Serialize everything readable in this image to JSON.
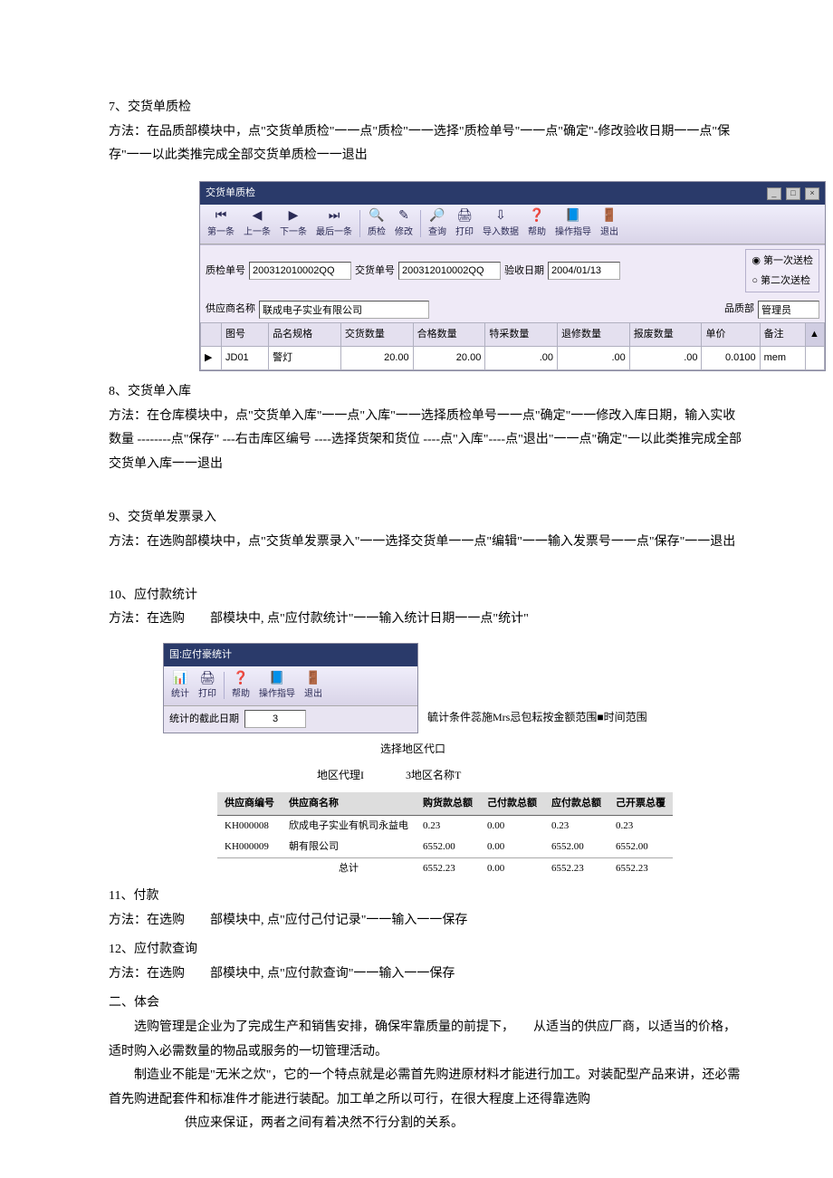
{
  "sec7": {
    "title": "7、交货单质检",
    "method": "方法：在品质部模块中，点\"交货单质检\"一一点\"质检\"一一选择\"质检单号\"一一点\"确定\"-修改验收日期一一点\"保存\"一一以此类推完成全部交货单质检一一退出"
  },
  "win1": {
    "title": "交货单质检",
    "toolbar": {
      "first": "第一条",
      "prev": "上一条",
      "next": "下一条",
      "last": "最后一条",
      "qc": "质检",
      "modify": "修改",
      "query": "查询",
      "print": "打印",
      "import": "导入数据",
      "help": "帮助",
      "guide": "操作指导",
      "exit": "退出"
    },
    "form": {
      "qc_no_lbl": "质检单号",
      "qc_no": "200312010002QQ",
      "dn_no_lbl": "交货单号",
      "dn_no": "200312010002QQ",
      "acc_date_lbl": "验收日期",
      "acc_date": "2004/01/13",
      "supplier_lbl": "供应商名称",
      "supplier": "联成电子实业有限公司",
      "dept_lbl": "品质部",
      "dept": "管理员",
      "r1": "第一次送检",
      "r2": "第二次送检"
    },
    "grid": {
      "cols": [
        "图号",
        "品名规格",
        "交货数量",
        "合格数量",
        "特采数量",
        "退修数量",
        "报废数量",
        "单价",
        "备注"
      ],
      "row_mark": "▶",
      "row": [
        "JD01",
        "警灯",
        "20.00",
        "20.00",
        ".00",
        ".00",
        ".00",
        "0.0100",
        "mem"
      ]
    }
  },
  "sec8": {
    "title": "8、交货单入库",
    "method": "方法：在仓库模块中，点\"交货单入库\"一一点\"入库\"一一选择质检单号一一点\"确定\"一一修改入库日期，输入实收数量 --------点\"保存\" ---右击库区编号 ----选择货架和货位 ----点\"入库\"----点\"退出\"一一点\"确定\"一以此类推完成全部交货单入库一一退出"
  },
  "sec9": {
    "title": "9、交货单发票录入",
    "method": "方法：在选购部模块中，点\"交货单发票录入\"一一选择交货单一一点\"编辑\"一一输入发票号一一点\"保存\"一一退出"
  },
  "sec10": {
    "title": "10、应付款统计",
    "method": "方法：在选购　　部模块中, 点\"应付款统计\"一一输入统计日期一一点\"统计\""
  },
  "win2": {
    "title": "国:应付豪统计",
    "toolbar": {
      "stat": "统计",
      "print": "打印",
      "help": "帮助",
      "guide": "操作指导",
      "exit": "退出"
    },
    "date_lbl": "统计的截此日期",
    "date_val": "3",
    "cond": "毓计条件蕊施Mrs忌包耘按金额范围■时间范围",
    "select_area": "选择地区代口",
    "area_agent_lbl": "地区代理I",
    "area_name_lbl": "3地区名称T"
  },
  "payable": {
    "sup_code_lbl": "供应商编号",
    "sup_name_lbl": "供应商名称",
    "cols": [
      "购货款总额",
      "己付款总额",
      "应付款总额",
      "己开票总覆"
    ],
    "rows": [
      {
        "code": "KH000008",
        "name": "欣成电子实业有帆司永益电",
        "v": [
          "0.23",
          "0.00",
          "0.23",
          "0.23"
        ]
      },
      {
        "code": "KH000009",
        "name": "朝有限公司",
        "v": [
          "6552.00",
          "0.00",
          "6552.00",
          "6552.00"
        ]
      }
    ],
    "total_lbl": "总计",
    "total": [
      "6552.23",
      "0.00",
      "6552.23",
      "6552.23"
    ]
  },
  "sec11": {
    "title": "11、付款",
    "method": "方法：在选购　　部模块中, 点\"应付己付记录\"一一输入一一保存"
  },
  "sec12": {
    "title": "12、应付款查询",
    "method": "方法：在选购　　部模块中, 点\"应付款查询\"一一输入一一保存"
  },
  "sec_tihui": {
    "title": "二、体会",
    "p1": "选购管理是企业为了完成生产和销售安排，确保牢靠质量的前提下，　　从适当的供应厂商，以适当的价格，适时购入必需数量的物品或服务的一切管理活动。",
    "p2": "制造业不能是\"无米之炊\"，它的一个特点就是必需首先购进原材料才能进行加工。对装配型产品来讲，还必需首先购进配套件和标准件才能进行装配。加工单之所以可行，在很大程度上还得靠选购",
    "p3": "供应来保证，两者之间有着决然不行分割的关系。"
  }
}
